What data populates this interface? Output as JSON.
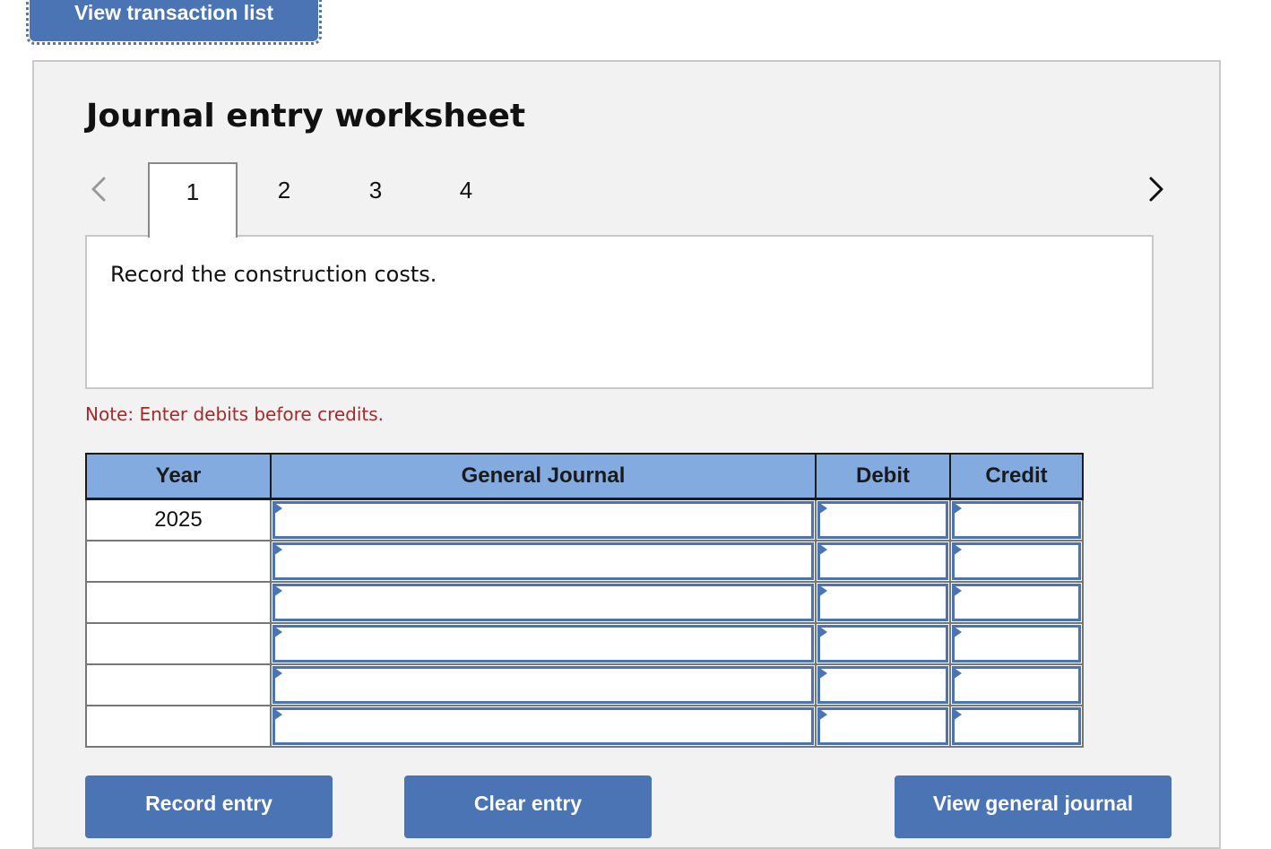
{
  "top_button": {
    "label": "View transaction list"
  },
  "worksheet": {
    "title": "Journal entry worksheet",
    "tabs": [
      {
        "label": "1",
        "active": true
      },
      {
        "label": "2",
        "active": false
      },
      {
        "label": "3",
        "active": false
      },
      {
        "label": "4",
        "active": false
      }
    ],
    "prev_icon": "chevron-left-icon",
    "next_icon": "chevron-right-icon",
    "prompt": "Record the construction costs.",
    "note": "Note: Enter debits before credits."
  },
  "table": {
    "headers": {
      "year": "Year",
      "general_journal": "General Journal",
      "debit": "Debit",
      "credit": "Credit"
    },
    "rows": [
      {
        "year": "2025",
        "account": "",
        "debit": "",
        "credit": ""
      },
      {
        "year": "",
        "account": "",
        "debit": "",
        "credit": ""
      },
      {
        "year": "",
        "account": "",
        "debit": "",
        "credit": ""
      },
      {
        "year": "",
        "account": "",
        "debit": "",
        "credit": ""
      },
      {
        "year": "",
        "account": "",
        "debit": "",
        "credit": ""
      },
      {
        "year": "",
        "account": "",
        "debit": "",
        "credit": ""
      }
    ]
  },
  "buttons": {
    "record": "Record entry",
    "clear": "Clear entry",
    "view_journal": "View general journal"
  },
  "colors": {
    "accent": "#4a74b4",
    "header": "#84abdf",
    "note": "#a52a2a",
    "panel": "#f2f2f2"
  }
}
